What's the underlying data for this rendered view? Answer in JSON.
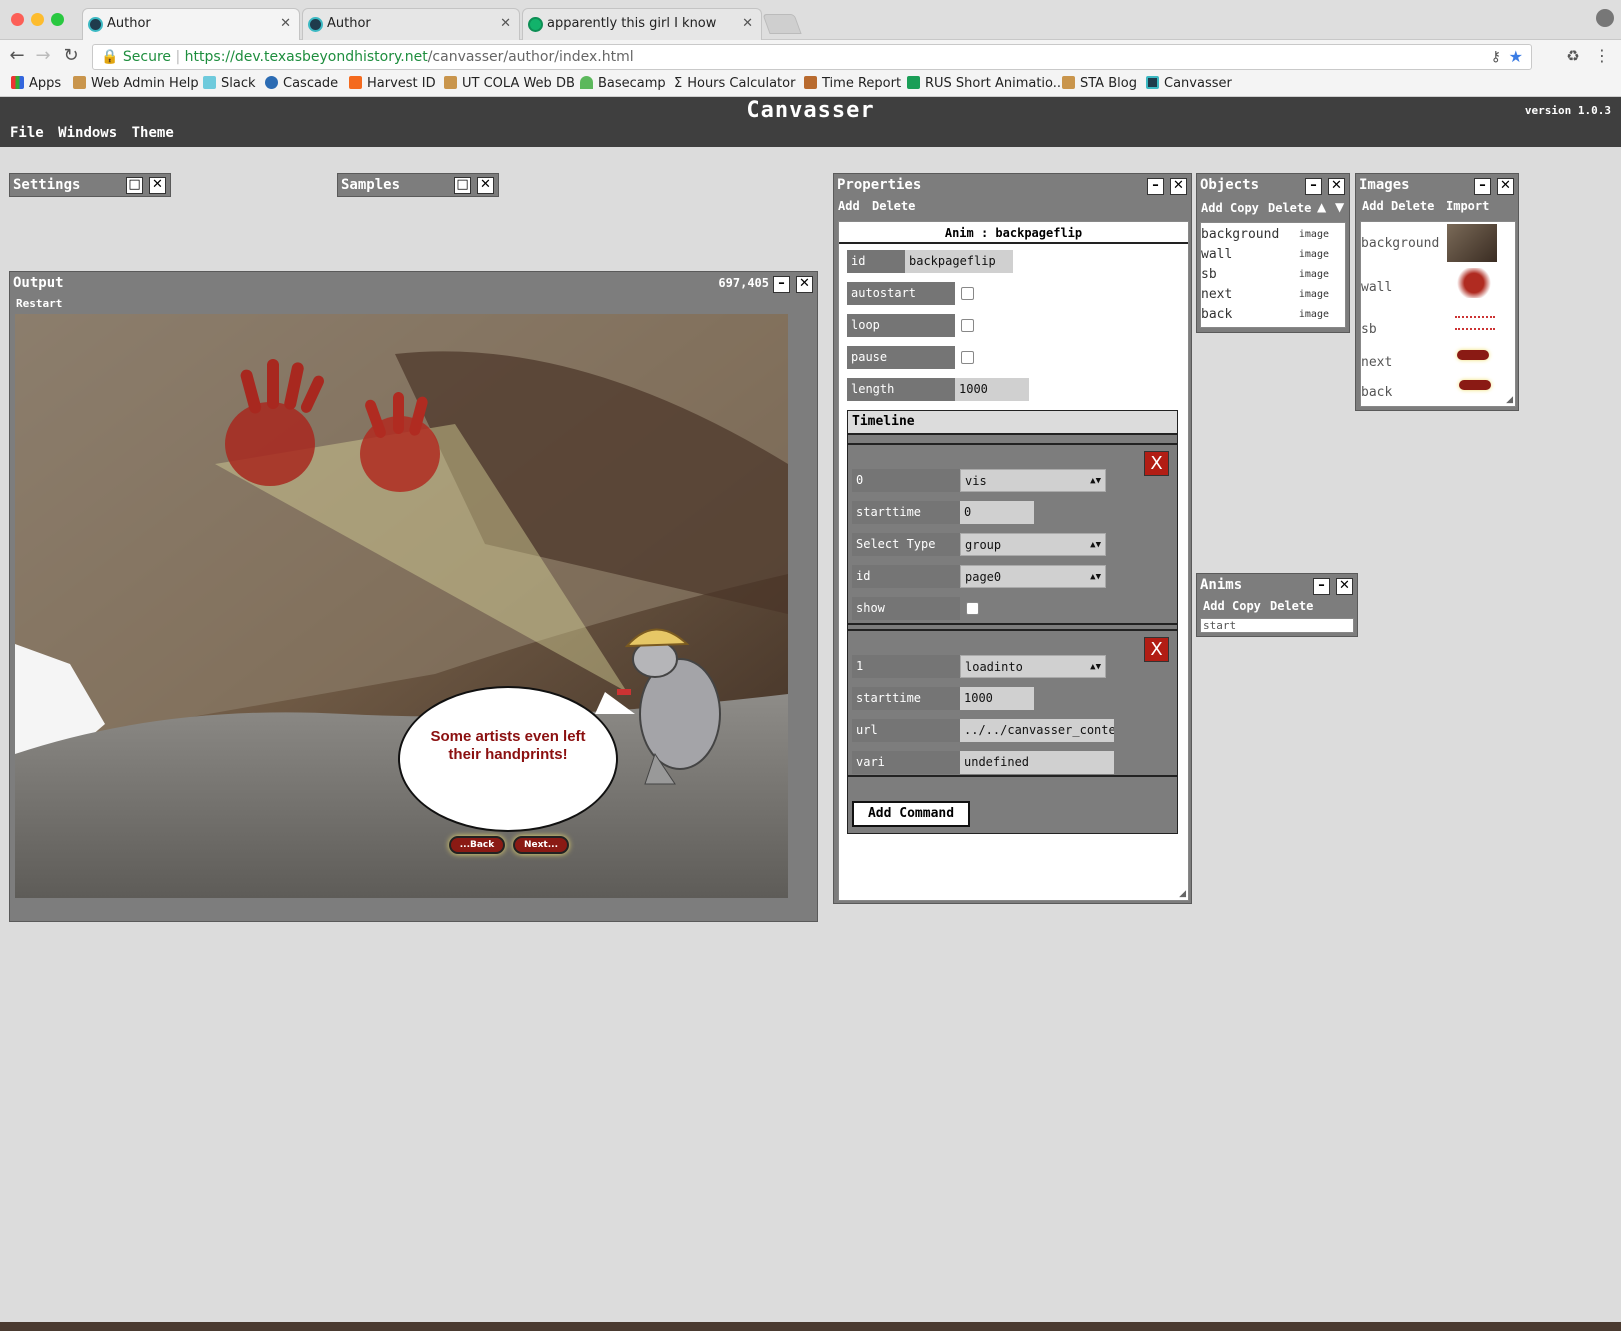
{
  "browser": {
    "tabs": [
      {
        "title": "Author",
        "active": true
      },
      {
        "title": "Author",
        "active": false
      },
      {
        "title": "apparently this girl I know just",
        "active": false
      }
    ],
    "secure_label": "Secure",
    "url_host": "https://dev.texasbeyondhistory.net",
    "url_path": "/canvasser/author/index.html",
    "bookmarks": [
      "Apps",
      "Web Admin Help",
      "Slack",
      "Cascade",
      "Harvest ID",
      "UT COLA Web DB",
      "Basecamp",
      "Hours Calculator",
      "Time Report",
      "RUS Short Animatio...",
      "STA Blog",
      "Canvasser"
    ]
  },
  "app": {
    "title": "Canvasser",
    "version": "version 1.0.3",
    "menu": [
      "File",
      "Windows",
      "Theme"
    ]
  },
  "settings": {
    "title": "Settings"
  },
  "samples": {
    "title": "Samples"
  },
  "output": {
    "title": "Output",
    "coords": "697,405",
    "restart": "Restart",
    "bubble_text": "Some artists even left their handprints!",
    "back_btn": "...Back",
    "next_btn": "Next..."
  },
  "properties": {
    "title": "Properties",
    "toolbar": [
      "Add",
      "Delete"
    ],
    "header": "Anim : backpageflip",
    "fields": {
      "id_label": "id",
      "id_value": "backpageflip",
      "autostart_label": "autostart",
      "loop_label": "loop",
      "pause_label": "pause",
      "length_label": "length",
      "length_value": "1000"
    },
    "timeline_label": "Timeline",
    "cmd0": {
      "index": "0",
      "type": "vis",
      "starttime_label": "starttime",
      "starttime": "0",
      "seltype_label": "Select Type",
      "seltype": "group",
      "id_label": "id",
      "id": "page0",
      "show_label": "show"
    },
    "cmd1": {
      "index": "1",
      "type": "loadinto",
      "starttime_label": "starttime",
      "starttime": "1000",
      "url_label": "url",
      "url": "../../canvasser_conten",
      "vari_label": "vari",
      "vari": "undefined"
    },
    "add_command": "Add Command",
    "x_label": "X"
  },
  "objects": {
    "title": "Objects",
    "toolbar": [
      "Add",
      "Copy",
      "Delete"
    ],
    "items": [
      {
        "name": "background",
        "type": "image"
      },
      {
        "name": "wall",
        "type": "image"
      },
      {
        "name": "sb",
        "type": "image"
      },
      {
        "name": "next",
        "type": "image"
      },
      {
        "name": "back",
        "type": "image"
      }
    ]
  },
  "images": {
    "title": "Images",
    "toolbar": [
      "Add",
      "Delete",
      "Import"
    ],
    "items": [
      "background",
      "wall",
      "sb",
      "next",
      "back"
    ]
  },
  "anims": {
    "title": "Anims",
    "toolbar": [
      "Add",
      "Copy",
      "Delete"
    ],
    "items": [
      "start"
    ]
  },
  "colors": {
    "accent_red": "#b21d14",
    "app_bar": "#3f3f3f",
    "panel": "#7d7d7d"
  }
}
